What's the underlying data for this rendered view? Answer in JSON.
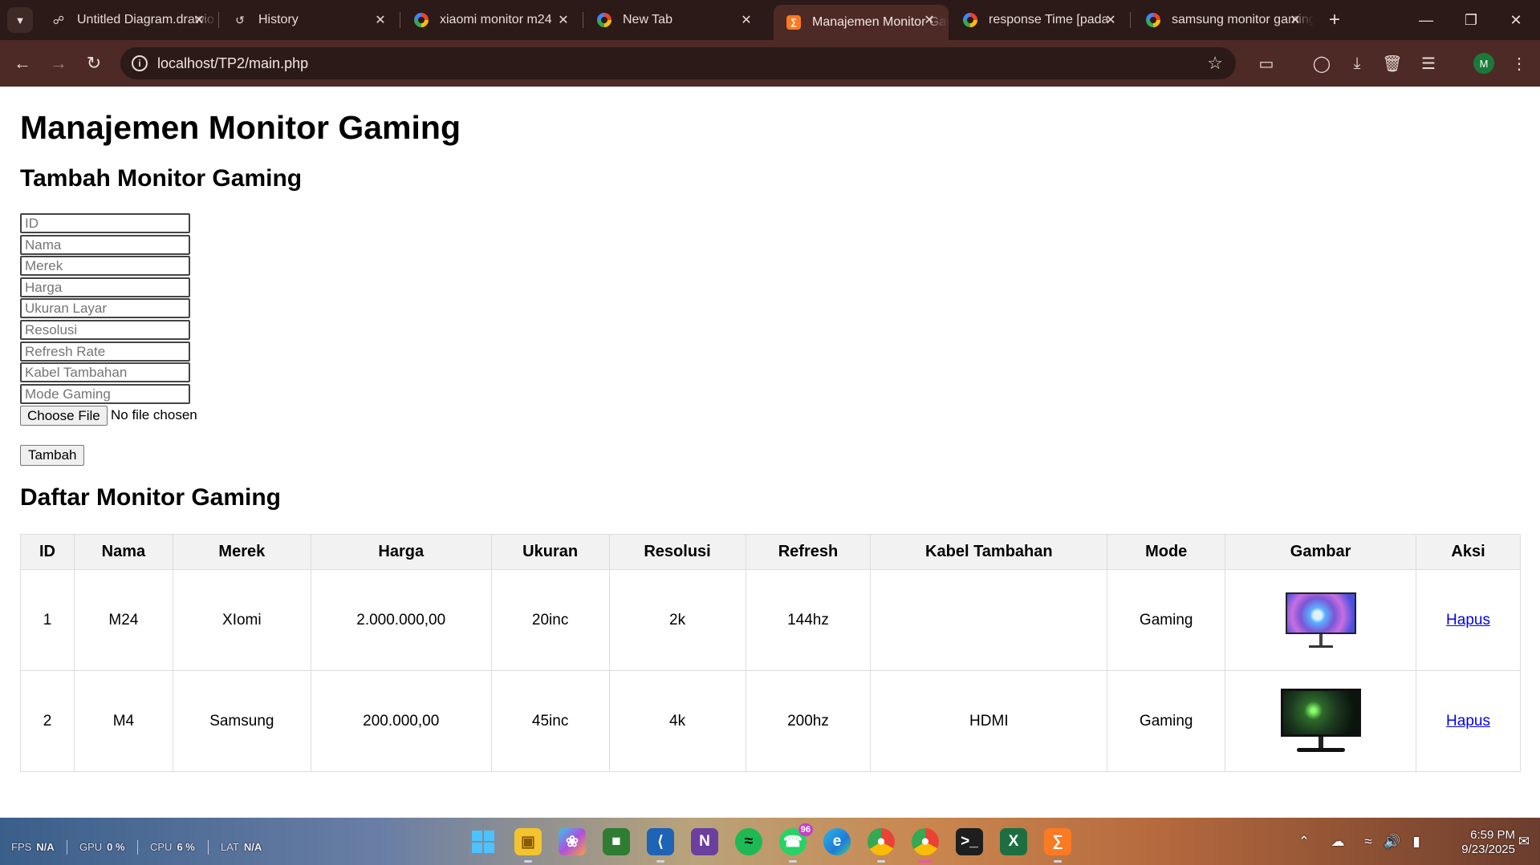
{
  "browser": {
    "tabs": [
      {
        "title": "Untitled Diagram.drawio",
        "favicon": "drawio-icon"
      },
      {
        "title": "History",
        "favicon": "history-icon"
      },
      {
        "title": "xiaomi monitor m24",
        "favicon": "google-icon"
      },
      {
        "title": "New Tab",
        "favicon": "chrome-icon"
      },
      {
        "title": "Manajemen Monitor Gaming",
        "favicon": "xampp-icon",
        "active": true
      },
      {
        "title": "response Time [pada",
        "favicon": "google-icon"
      },
      {
        "title": "samsung monitor gaming",
        "favicon": "google-icon"
      }
    ],
    "url": "localhost/TP2/main.php",
    "profile_initial": "M"
  },
  "page": {
    "title": "Manajemen Monitor Gaming",
    "form_heading": "Tambah Monitor Gaming",
    "form": {
      "placeholders": {
        "id": "ID",
        "nama": "Nama",
        "merek": "Merek",
        "harga": "Harga",
        "ukuran": "Ukuran Layar",
        "resolusi": "Resolusi",
        "refresh": "Refresh Rate",
        "kabel": "Kabel Tambahan",
        "mode": "Mode Gaming"
      },
      "file_button": "Choose File",
      "file_status": "No file chosen",
      "submit_label": "Tambah"
    },
    "list_heading": "Daftar Monitor Gaming",
    "table": {
      "headers": [
        "ID",
        "Nama",
        "Merek",
        "Harga",
        "Ukuran",
        "Resolusi",
        "Refresh",
        "Kabel Tambahan",
        "Mode",
        "Gambar",
        "Aksi"
      ],
      "rows": [
        {
          "id": "1",
          "nama": "M24",
          "merek": "XIomi",
          "harga": "2.000.000,00",
          "ukuran": "20inc",
          "resolusi": "2k",
          "refresh": "144hz",
          "kabel": "",
          "mode": "Gaming",
          "aksi": "Hapus"
        },
        {
          "id": "2",
          "nama": "M4",
          "merek": "Samsung",
          "harga": "200.000,00",
          "ukuran": "45inc",
          "resolusi": "4k",
          "refresh": "200hz",
          "kabel": "HDMI",
          "mode": "Gaming",
          "aksi": "Hapus"
        }
      ]
    }
  },
  "taskbar": {
    "perf": {
      "fps_label": "FPS",
      "fps_value": "N/A",
      "gpu_label": "GPU",
      "gpu_value": "0 %",
      "cpu_label": "CPU",
      "cpu_value": "6 %",
      "lat_label": "LAT",
      "lat_value": "N/A"
    },
    "whatsapp_badge": "96",
    "time": "6:59 PM",
    "date": "9/23/2025"
  }
}
